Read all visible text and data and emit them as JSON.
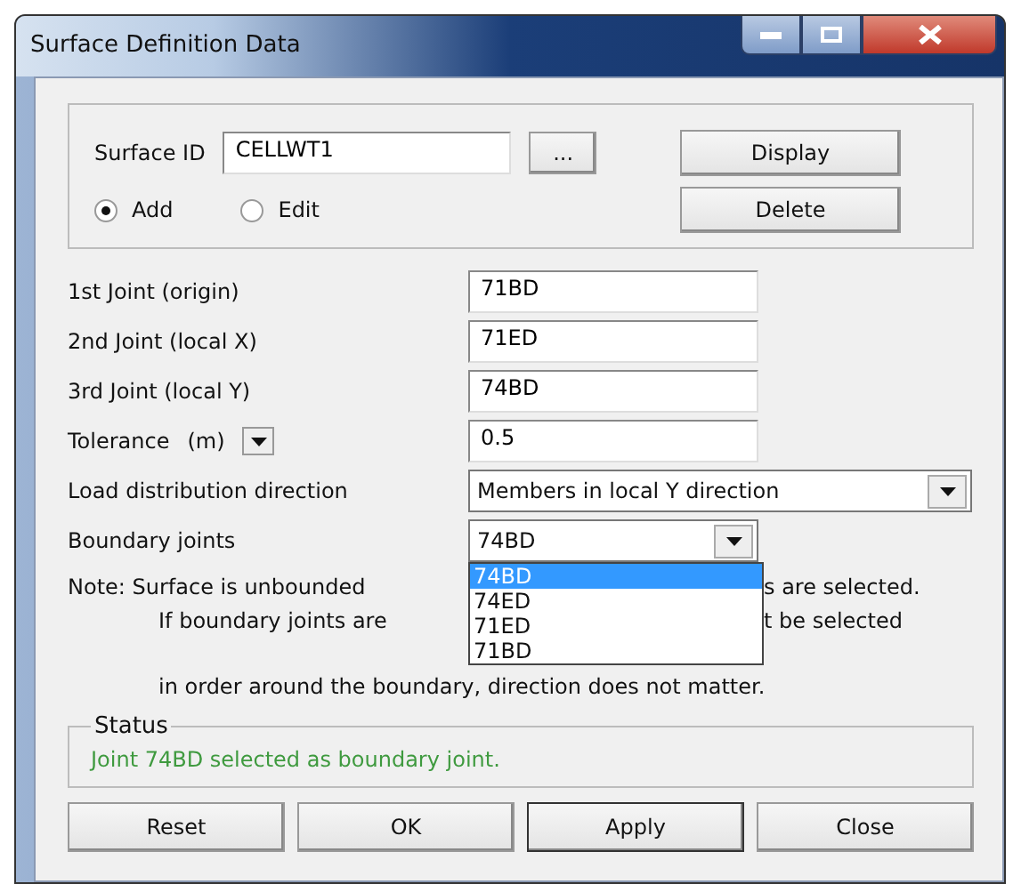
{
  "window": {
    "title": "Surface Definition Data"
  },
  "surface": {
    "label": "Surface ID",
    "value": "CELLWT1",
    "browse": "...",
    "actions": [
      "Display",
      "Delete"
    ],
    "modes": [
      {
        "label": "Add",
        "selected": true
      },
      {
        "label": "Edit",
        "selected": false
      }
    ]
  },
  "fields": [
    {
      "kind": "text",
      "label": "1st Joint (origin)",
      "value": "71BD"
    },
    {
      "kind": "text",
      "label": "2nd Joint (local X)",
      "value": "71ED"
    },
    {
      "kind": "text",
      "label": "3rd Joint (local Y)",
      "value": "74BD"
    },
    {
      "kind": "unit",
      "label": "Tolerance",
      "unit": "(m)",
      "value": "0.5"
    },
    {
      "kind": "wide-dropdown",
      "label": "Load distribution direction",
      "value": "Members in local Y direction"
    },
    {
      "kind": "dropdown",
      "label": "Boundary joints",
      "value": "74BD",
      "expanded": true
    }
  ],
  "boundary_options": [
    {
      "label": "74BD",
      "selected": true
    },
    {
      "label": "74ED",
      "selected": false
    },
    {
      "label": "71ED",
      "selected": false
    },
    {
      "label": "71BD",
      "selected": false
    }
  ],
  "note": [
    {
      "left": "Note: Surface is unbounded",
      "right": "s are selected."
    },
    {
      "left": "If boundary joints are",
      "right": "t be selected"
    },
    {
      "left": "in order around the boundary, direction does not matter."
    }
  ],
  "status": {
    "title": "Status",
    "message": "Joint 74BD selected as boundary joint."
  },
  "buttons": [
    {
      "label": "Reset",
      "default": false
    },
    {
      "label": "OK",
      "default": false
    },
    {
      "label": "Apply",
      "default": true
    },
    {
      "label": "Close",
      "default": false
    }
  ]
}
